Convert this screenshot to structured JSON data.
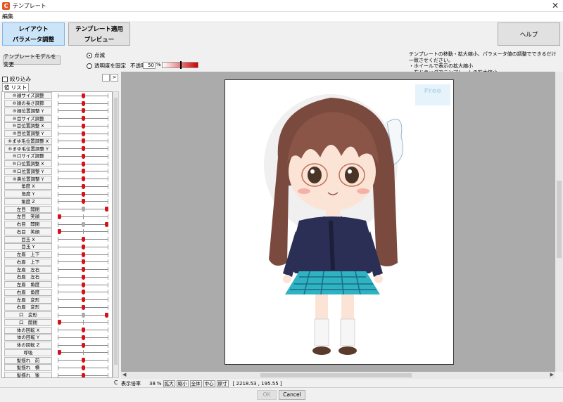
{
  "window": {
    "title": "テンプレート",
    "app_icon": "app-logo-icon",
    "close_icon": "close-icon"
  },
  "menu": {
    "edit": "編集"
  },
  "mode_buttons": {
    "layout_line1": "レイアウト",
    "layout_line2": "パラメータ調整",
    "apply_line1": "テンプレート適用",
    "apply_line2": "プレビュー"
  },
  "help_button": "ヘルプ",
  "change_model_button": "テンプレートモデルを変更",
  "display": {
    "blink_label": "点滅",
    "fixed_opacity_label": "透明度を固定",
    "opacity_label": "不透明度",
    "opacity_value": "50",
    "opacity_unit": "%",
    "opacity_level": 0.5
  },
  "info_lines": [
    "テンプレートの移動・拡大縮小、パラメータ値の調整でできるだけ一致させください。",
    "・ホイールで表示の拡大縮小",
    "・右ドラッグでテンプレートの拡大縮小"
  ],
  "filter": {
    "label": "絞り込み",
    "btn_a": "",
    "btn_b": ">"
  },
  "list_tab": "値 リスト",
  "params": [
    {
      "label": "®顔サイズ調整",
      "pos": 0.5
    },
    {
      "label": "®顔の長さ調節",
      "pos": 0.5
    },
    {
      "label": "®顔位置調整 Y",
      "pos": 0.5
    },
    {
      "label": "®目サイズ調整",
      "pos": 0.5
    },
    {
      "label": "®目位置調整 X",
      "pos": 0.5
    },
    {
      "label": "®目位置調整 Y",
      "pos": 0.5
    },
    {
      "label": "®まゆ毛位置調整 X",
      "pos": 0.5
    },
    {
      "label": "®まゆ毛位置調整 Y",
      "pos": 0.5
    },
    {
      "label": "®口サイズ調整",
      "pos": 0.5
    },
    {
      "label": "®口位置調整 X",
      "pos": 0.5
    },
    {
      "label": "®口位置調整 Y",
      "pos": 0.5
    },
    {
      "label": "®鼻位置調整 Y",
      "pos": 0.5
    },
    {
      "label": "角度 X",
      "pos": 0.5
    },
    {
      "label": "角度 Y",
      "pos": 0.5
    },
    {
      "label": "角度 Z",
      "pos": 0.5
    },
    {
      "label": "左目　開閉",
      "pos": 1.0,
      "grey": 0.5
    },
    {
      "label": "左目　笑顔",
      "pos": 0.0
    },
    {
      "label": "右目　開閉",
      "pos": 1.0,
      "grey": 0.5
    },
    {
      "label": "右目　笑顔",
      "pos": 0.0
    },
    {
      "label": "目玉 X",
      "pos": 0.5
    },
    {
      "label": "目玉 Y",
      "pos": 0.5
    },
    {
      "label": "左眉　上下",
      "pos": 0.5
    },
    {
      "label": "右眉　上下",
      "pos": 0.5
    },
    {
      "label": "左眉　左右",
      "pos": 0.5
    },
    {
      "label": "右眉　左右",
      "pos": 0.5
    },
    {
      "label": "左眉　角度",
      "pos": 0.5
    },
    {
      "label": "右眉　角度",
      "pos": 0.5
    },
    {
      "label": "左眉　変形",
      "pos": 0.5
    },
    {
      "label": "右眉　変形",
      "pos": 0.5
    },
    {
      "label": "口　変形",
      "pos": 1.0,
      "grey": 0.5
    },
    {
      "label": "口　開閉",
      "pos": 0.0
    },
    {
      "label": "体の回転 X",
      "pos": 0.5
    },
    {
      "label": "体の回転 Y",
      "pos": 0.5
    },
    {
      "label": "体の回転 Z",
      "pos": 0.5
    },
    {
      "label": "呼吸",
      "pos": 0.0
    },
    {
      "label": "髪揺れ　前",
      "pos": 0.5
    },
    {
      "label": "髪揺れ　横",
      "pos": 0.5
    },
    {
      "label": "髪揺れ　後",
      "pos": 0.5
    }
  ],
  "corner_label": "C",
  "status": {
    "zoom_label": "表示倍率",
    "zoom_value": "38",
    "zoom_unit": "%",
    "zoom_in": "拡大",
    "zoom_out": "縮小",
    "fit_all": "全体",
    "center": "中心",
    "actual_size": "原寸",
    "coords": "[ 2218.53 ,   195.55 ]"
  },
  "dialog": {
    "ok": "OK",
    "cancel": "Cancel"
  },
  "preview": {
    "watermark": "Free"
  }
}
